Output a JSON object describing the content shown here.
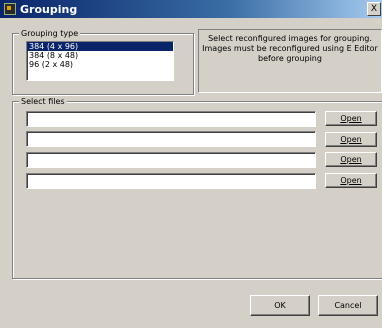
{
  "window": {
    "title": "Grouping",
    "close_glyph": "X"
  },
  "grouping_type": {
    "legend": "Grouping type",
    "items": [
      {
        "label": "384  (4 x 96)",
        "selected": true
      },
      {
        "label": "384 (8 x 48)",
        "selected": false
      },
      {
        "label": "96 (2 x 48)",
        "selected": false
      }
    ]
  },
  "info": {
    "line1": "Select reconfigured images for grouping.",
    "line2": "Images must be reconfigured using E Editor",
    "line3": "before grouping"
  },
  "select_files": {
    "legend": "Select files",
    "rows": [
      {
        "value": "",
        "open_label": "Open"
      },
      {
        "value": "",
        "open_label": "Open"
      },
      {
        "value": "",
        "open_label": "Open"
      },
      {
        "value": "",
        "open_label": "Open"
      }
    ]
  },
  "buttons": {
    "ok": "OK",
    "cancel": "Cancel"
  }
}
